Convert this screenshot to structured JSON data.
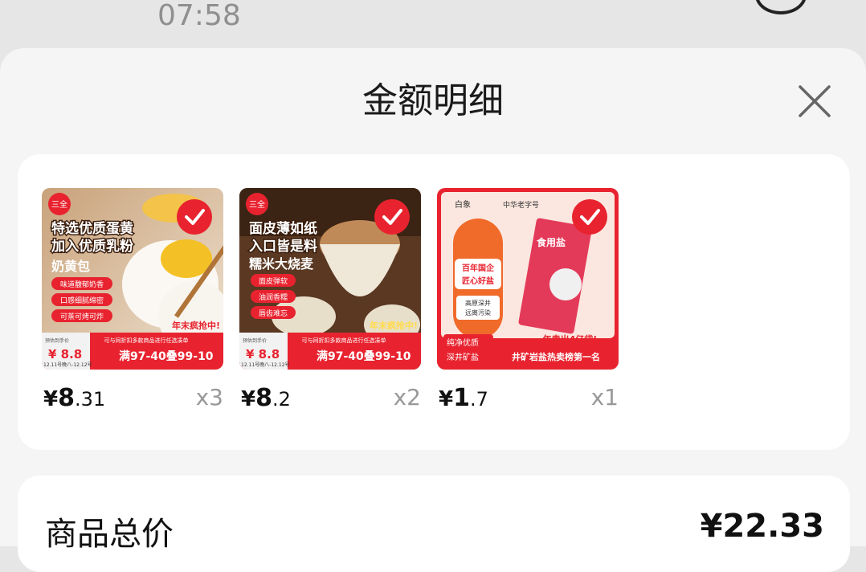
{
  "status": {
    "time": "07:58"
  },
  "sheet": {
    "title": "金额明细"
  },
  "products": [
    {
      "image_text": {
        "brand": "三全",
        "headline1": "特选优质蛋黄",
        "headline2": "加入优质乳粉",
        "name": "奶黄包",
        "tags": [
          "味道馥郁奶香",
          "口感细腻绵密",
          "可蒸可烤可炸"
        ],
        "promo_badge": "年末疯抢中!",
        "banner_top": "可与同折扣多款商品进行任选凑单",
        "est_label": "预估到手价",
        "est_price": "¥ 8.8",
        "banner_main": "满97-40叠99-10",
        "dates": "12.11号晚八-12.12号"
      },
      "price_currency": "¥",
      "price_int": "8",
      "price_dec": ".31",
      "qty": "x3"
    },
    {
      "image_text": {
        "brand": "三全",
        "headline1": "面皮薄如纸",
        "headline2": "入口皆是料",
        "name": "糯米大烧麦",
        "tags": [
          "面皮弹软",
          "油润香糯",
          "唇齿难忘"
        ],
        "promo_badge": "年末疯抢中!",
        "banner_top": "可与同折扣多款商品进行任选凑单",
        "est_label": "预估到手价",
        "est_price": "¥ 8.8",
        "banner_main": "满97-40叠99-10",
        "dates": "12.11号晚八-12.12号"
      },
      "price_currency": "¥",
      "price_int": "8",
      "price_dec": ".2",
      "qty": "x2"
    },
    {
      "image_text": {
        "brand": "白象",
        "brand2": "中华老字号",
        "bag_title": "食用盐",
        "tag1": "百年国企",
        "tag2": "匠心好盐",
        "tag3": "高原深井",
        "tag4": "远离污染",
        "slogan": "一年卖出4亿袋!",
        "left_top": "纯净优质",
        "left_bottom": "深井矿盐",
        "bottom": "井矿岩盐热卖榜第一名"
      },
      "price_currency": "¥",
      "price_int": "1",
      "price_dec": ".7",
      "qty": "x1"
    }
  ],
  "summary": {
    "label": "商品总价",
    "value": "¥22.33"
  },
  "colors": {
    "accent": "#e8232f",
    "background": "#f5f5f5"
  }
}
